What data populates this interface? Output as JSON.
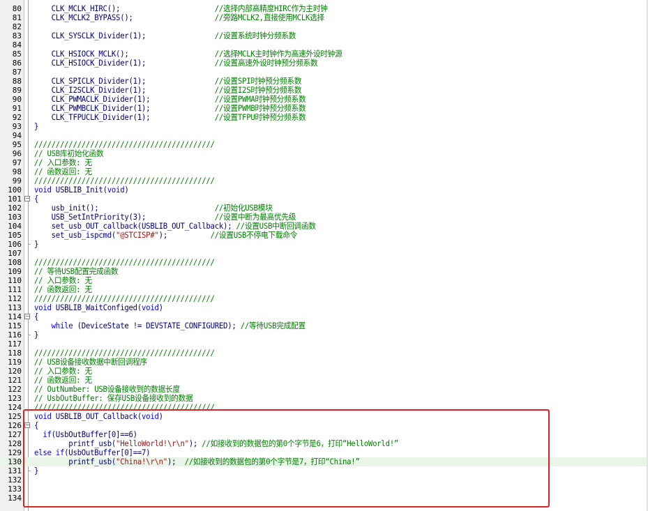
{
  "lines": [
    {
      "n": "80",
      "text": "    CLK_MCLK_HIRC();                      //选择内部高精度HIRC作为主时钟",
      "type": "code"
    },
    {
      "n": "81",
      "text": "    CLK_MCLK2_BYPASS();                   //旁路MCLK2,直接使用MCLK选择",
      "type": "code"
    },
    {
      "n": "82",
      "text": "",
      "type": "code"
    },
    {
      "n": "83",
      "text": "    CLK_SYSCLK_Divider(1);                //设置系统时钟分频系数",
      "type": "code"
    },
    {
      "n": "84",
      "text": "",
      "type": "code"
    },
    {
      "n": "85",
      "text": "    CLK_HSIOCK_MCLK();                    //选择MCLK主时钟作为高速外设时钟源",
      "type": "code"
    },
    {
      "n": "86",
      "text": "    CLK_HSIOCK_Divider(1);                //设置高速外设时钟预分频系数",
      "type": "code"
    },
    {
      "n": "87",
      "text": "",
      "type": "code"
    },
    {
      "n": "88",
      "text": "    CLK_SPICLK_Divider(1);                //设置SPI时钟预分频系数",
      "type": "code"
    },
    {
      "n": "89",
      "text": "    CLK_I2SCLK_Divider(1);                //设置I2S时钟预分频系数",
      "type": "code"
    },
    {
      "n": "90",
      "text": "    CLK_PWMACLK_Divider(1);               //设置PWMA时钟预分频系数",
      "type": "code"
    },
    {
      "n": "91",
      "text": "    CLK_PWMBCLK_Divider(1);               //设置PWMB时钟预分频系数",
      "type": "code"
    },
    {
      "n": "92",
      "text": "    CLK_TFPUCLK_Divider(1);               //设置TFPU时钟预分频系数",
      "type": "code"
    },
    {
      "n": "93",
      "text": "}",
      "type": "code"
    },
    {
      "n": "94",
      "text": "",
      "type": "code"
    },
    {
      "n": "95",
      "text": "//////////////////////////////////////////",
      "type": "comment"
    },
    {
      "n": "96",
      "text": "// USB库初始化函数",
      "type": "comment"
    },
    {
      "n": "97",
      "text": "// 入口参数: 无",
      "type": "comment"
    },
    {
      "n": "98",
      "text": "// 函数返回: 无",
      "type": "comment"
    },
    {
      "n": "99",
      "text": "//////////////////////////////////////////",
      "type": "comment"
    },
    {
      "n": "100",
      "text": "void USBLIB_Init(void)",
      "type": "code"
    },
    {
      "n": "101",
      "text": "{",
      "type": "code",
      "fold": "open"
    },
    {
      "n": "102",
      "text": "    usb_init();                           //初始化USB模块",
      "type": "code"
    },
    {
      "n": "103",
      "text": "    USB_SetIntPriority(3);                //设置中断为最高优先级",
      "type": "code"
    },
    {
      "n": "104",
      "text": "    set_usb_OUT_callback(USBLIB_OUT_Callback); //设置USB中断回调函数",
      "type": "code"
    },
    {
      "n": "105",
      "text": "    set_usb_ispcmd(\"@STCISP#\");          //设置USB不停电下载命令",
      "type": "code"
    },
    {
      "n": "106",
      "text": "}",
      "type": "code",
      "fold": "end"
    },
    {
      "n": "107",
      "text": "",
      "type": "code"
    },
    {
      "n": "108",
      "text": "//////////////////////////////////////////",
      "type": "comment"
    },
    {
      "n": "109",
      "text": "// 等待USB配置完成函数",
      "type": "comment"
    },
    {
      "n": "110",
      "text": "// 入口参数: 无",
      "type": "comment"
    },
    {
      "n": "111",
      "text": "// 函数返回: 无",
      "type": "comment"
    },
    {
      "n": "112",
      "text": "//////////////////////////////////////////",
      "type": "comment"
    },
    {
      "n": "113",
      "text": "void USBLIB_WaitConfiged(void)",
      "type": "code"
    },
    {
      "n": "114",
      "text": "{",
      "type": "code",
      "fold": "open"
    },
    {
      "n": "115",
      "text": "    while (DeviceState != DEVSTATE_CONFIGURED); //等待USB完成配置",
      "type": "code"
    },
    {
      "n": "116",
      "text": "}",
      "type": "code",
      "fold": "end"
    },
    {
      "n": "117",
      "text": "",
      "type": "code"
    },
    {
      "n": "118",
      "text": "//////////////////////////////////////////",
      "type": "comment"
    },
    {
      "n": "119",
      "text": "// USB设备接收数据中断回调程序",
      "type": "comment"
    },
    {
      "n": "120",
      "text": "// 入口参数: 无",
      "type": "comment"
    },
    {
      "n": "121",
      "text": "// 函数返回: 无",
      "type": "comment"
    },
    {
      "n": "122",
      "text": "// OutNumber: USB设备接收到的数据长度",
      "type": "comment"
    },
    {
      "n": "123",
      "text": "// UsbOutBuffer: 保存USB设备接收到的数据",
      "type": "comment"
    },
    {
      "n": "124",
      "text": "//////////////////////////////////////////",
      "type": "comment"
    },
    {
      "n": "125",
      "text": "void USBLIB_OUT_Callback(void)",
      "type": "code"
    },
    {
      "n": "126",
      "text": "{",
      "type": "code",
      "fold": "open"
    },
    {
      "n": "127",
      "text": "  if(UsbOutBuffer[0]==6)",
      "type": "code"
    },
    {
      "n": "128",
      "text": "        printf_usb(\"HelloWorld!\\r\\n\"); //如接收到的数据包的第0个字节是6，打印“HelloWorld!”",
      "type": "code"
    },
    {
      "n": "129",
      "text": "else if(UsbOutBuffer[0]==7)",
      "type": "code"
    },
    {
      "n": "130",
      "text": "        printf_usb(\"China!\\r\\n\");  //如接收到的数据包的第0个字节是7，打印“China!”",
      "type": "code",
      "highlight": true
    },
    {
      "n": "131",
      "text": "}",
      "type": "code",
      "fold": "end"
    },
    {
      "n": "132",
      "text": "",
      "type": "code"
    },
    {
      "n": "133",
      "text": "",
      "type": "code"
    },
    {
      "n": "134",
      "text": "",
      "type": "code"
    }
  ],
  "colors": {
    "code": "#000080",
    "comment": "#008000",
    "keyword": "#0000ff",
    "string": "#a31515",
    "highlight_line": "#e8f5e8",
    "annotation_box": "#e02020"
  }
}
